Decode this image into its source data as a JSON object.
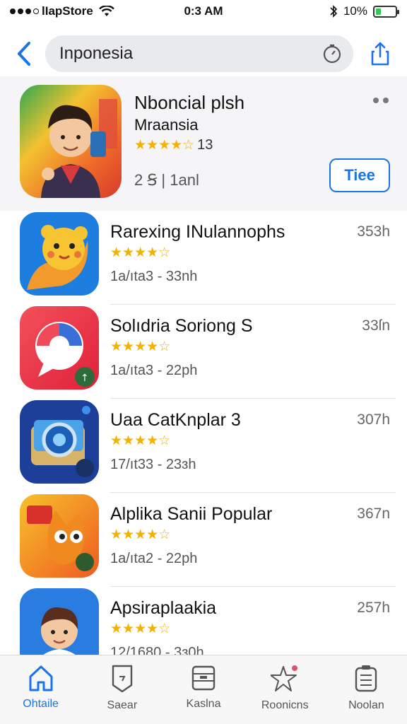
{
  "status_bar": {
    "carrier": "lIapStore",
    "time": "0:3 AM",
    "battery": "10%",
    "battery_level": 0.25
  },
  "search": {
    "value": "Inponesia",
    "icons": [
      "back-chevron-icon",
      "timer-icon",
      "share-icon"
    ]
  },
  "featured": {
    "title": "Nboncial plsh",
    "subtitle": "Mraansia",
    "stars": "★★★★☆",
    "rating_count": "13",
    "meta": "2 Ꞩ | 1anl",
    "get_label": "Tiee"
  },
  "apps": [
    {
      "title": "Rarexing INulannophs",
      "stars": "★★★★☆",
      "meta": "1a/ıta3 - 33nh",
      "size": "353h"
    },
    {
      "title": "Solıdria Soriong S",
      "stars": "★★★★☆",
      "meta": "1a/ıta3 - 22ph",
      "size": "33ſn"
    },
    {
      "title": "Uaa CatKnplar 3",
      "stars": "★★★★☆",
      "meta": "17/ıt33 - 23ɜh",
      "size": "307h"
    },
    {
      "title": "Alplika Sanii Popular",
      "stars": "★★★★☆",
      "meta": "1a/ıta2 - 22ph",
      "size": "367n"
    },
    {
      "title": "Apsiraplaakia",
      "stars": "★★★★☆",
      "meta": "12/1680 - 3ɜ0h",
      "size": "257h"
    }
  ],
  "tabs": [
    {
      "label": "Ohtaile",
      "icon": "home-icon"
    },
    {
      "label": "Saear",
      "icon": "document-icon"
    },
    {
      "label": "Kaslna",
      "icon": "box-icon"
    },
    {
      "label": "Roonicns",
      "icon": "star-icon"
    },
    {
      "label": "Noolan",
      "icon": "list-icon"
    }
  ],
  "colors": {
    "accent": "#1a73e8",
    "star": "#f5b000"
  }
}
